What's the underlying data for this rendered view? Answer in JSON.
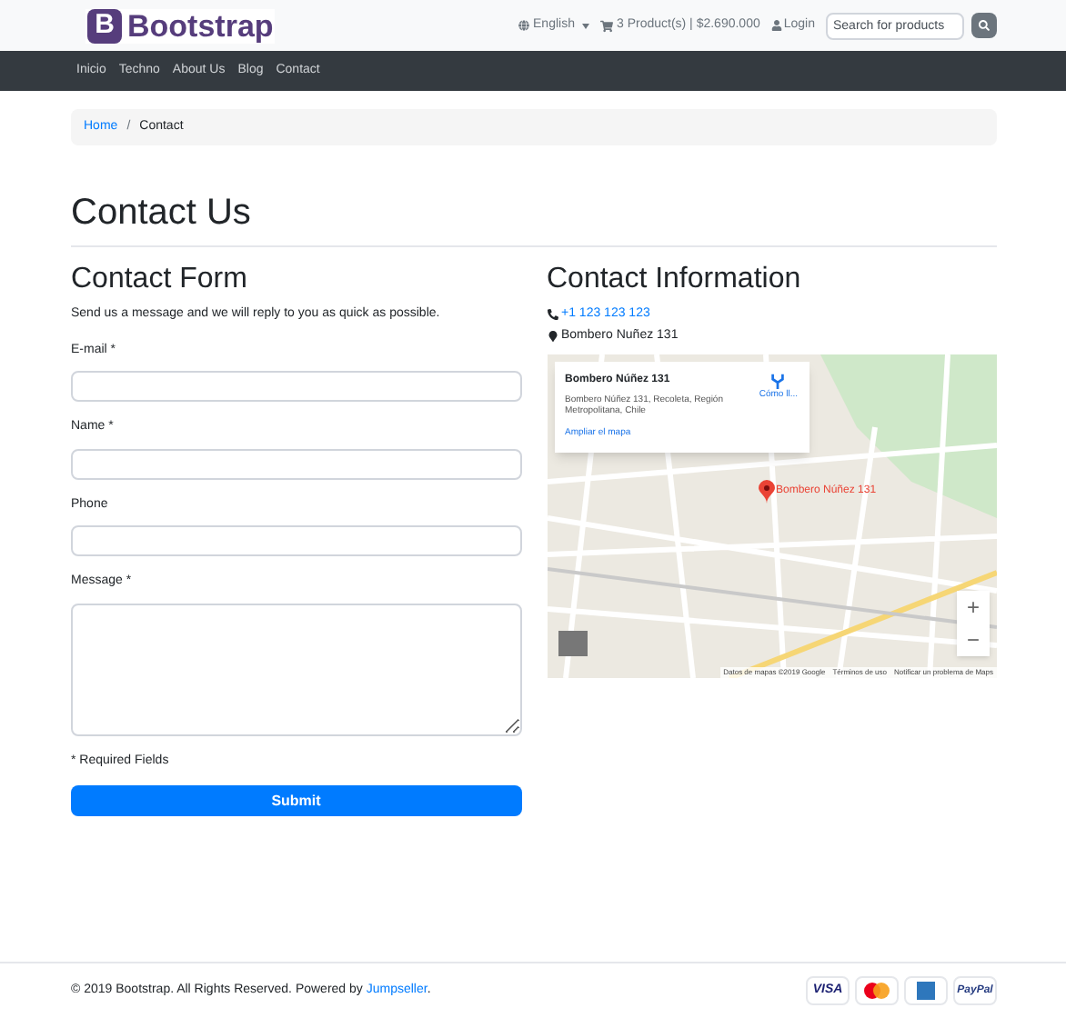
{
  "header": {
    "logo_letter": "B",
    "logo_text": "Bootstrap",
    "language": "English",
    "cart": "3 Product(s) | $2.690.000",
    "login": "Login",
    "search": {
      "placeholder": "Search for products"
    }
  },
  "nav": [
    {
      "label": "Inicio"
    },
    {
      "label": "Techno"
    },
    {
      "label": "About Us"
    },
    {
      "label": "Blog"
    },
    {
      "label": "Contact"
    }
  ],
  "breadcrumb_separator": "/",
  "breadcrumb": [
    {
      "label": "Home",
      "link": true
    },
    {
      "label": "Contact",
      "link": false
    }
  ],
  "page_title": "Contact Us",
  "form": {
    "title": "Contact Form",
    "intro": "Send us a message and we will reply to you as quick as possible.",
    "fields": [
      {
        "label": "E-mail *",
        "kind": "input"
      },
      {
        "label": "Name *",
        "kind": "input"
      },
      {
        "label": "Phone",
        "kind": "input"
      },
      {
        "label": "Message *",
        "kind": "textarea"
      }
    ],
    "note": "* Required Fields",
    "submit": "Submit"
  },
  "info": {
    "title": "Contact Information",
    "phone": "+1 123 123 123",
    "address": "Bombero Nuñez 131",
    "map": {
      "card_title": "Bombero Núñez 131",
      "card_address": "Bombero Núñez 131, Recoleta, Región Metropolitana, Chile",
      "directions": "Cómo ll...",
      "enlarge": "Ampliar el mapa",
      "marker_label": "Bombero Núñez 131",
      "zoom_in": "+",
      "zoom_out": "−",
      "attribution": [
        "Datos de mapas ©2019 Google",
        "Términos de uso",
        "Notificar un problema de Maps"
      ]
    }
  },
  "footer": {
    "copyright": "© 2019 Bootstrap. All Rights Reserved. Powered by ",
    "link": "Jumpseller",
    "end": ".",
    "payments": [
      {
        "kind": "visa",
        "label": "VISA"
      },
      {
        "kind": "mastercard"
      },
      {
        "kind": "amex"
      },
      {
        "kind": "paypal",
        "label": "PayPal"
      }
    ]
  }
}
